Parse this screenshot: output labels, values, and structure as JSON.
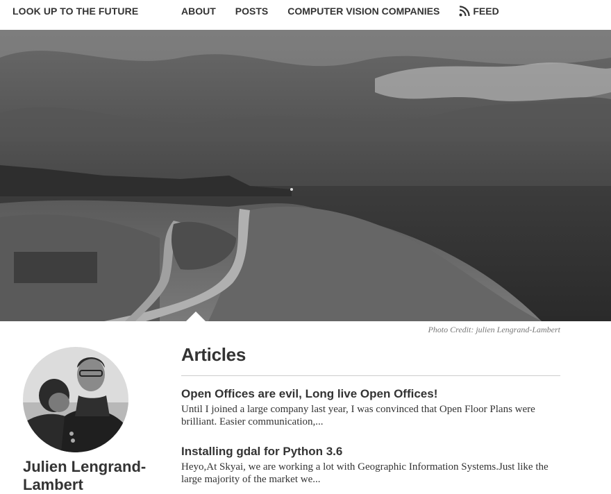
{
  "header": {
    "brand": "LOOK UP TO THE FUTURE",
    "nav": [
      {
        "label": "ABOUT"
      },
      {
        "label": "POSTS"
      },
      {
        "label": "COMPUTER VISION COMPANIES"
      },
      {
        "label": "FEED",
        "icon": "rss-icon"
      }
    ]
  },
  "hero": {
    "credit": "Photo Credit: julien Lengrand-Lambert"
  },
  "sidebar": {
    "author_name": "Julien Lengrand-Lambert"
  },
  "main": {
    "heading": "Articles",
    "articles": [
      {
        "title": "Open Offices are evil, Long live Open Offices!",
        "excerpt": "Until I joined a large company last year, I was convinced that Open Floor Plans were brilliant. Easier communication,..."
      },
      {
        "title": "Installing gdal for Python 3.6",
        "excerpt": "Heyo,At Skyai, we are working a lot with Geographic Information Systems.Just like the large majority of the market we..."
      }
    ]
  }
}
